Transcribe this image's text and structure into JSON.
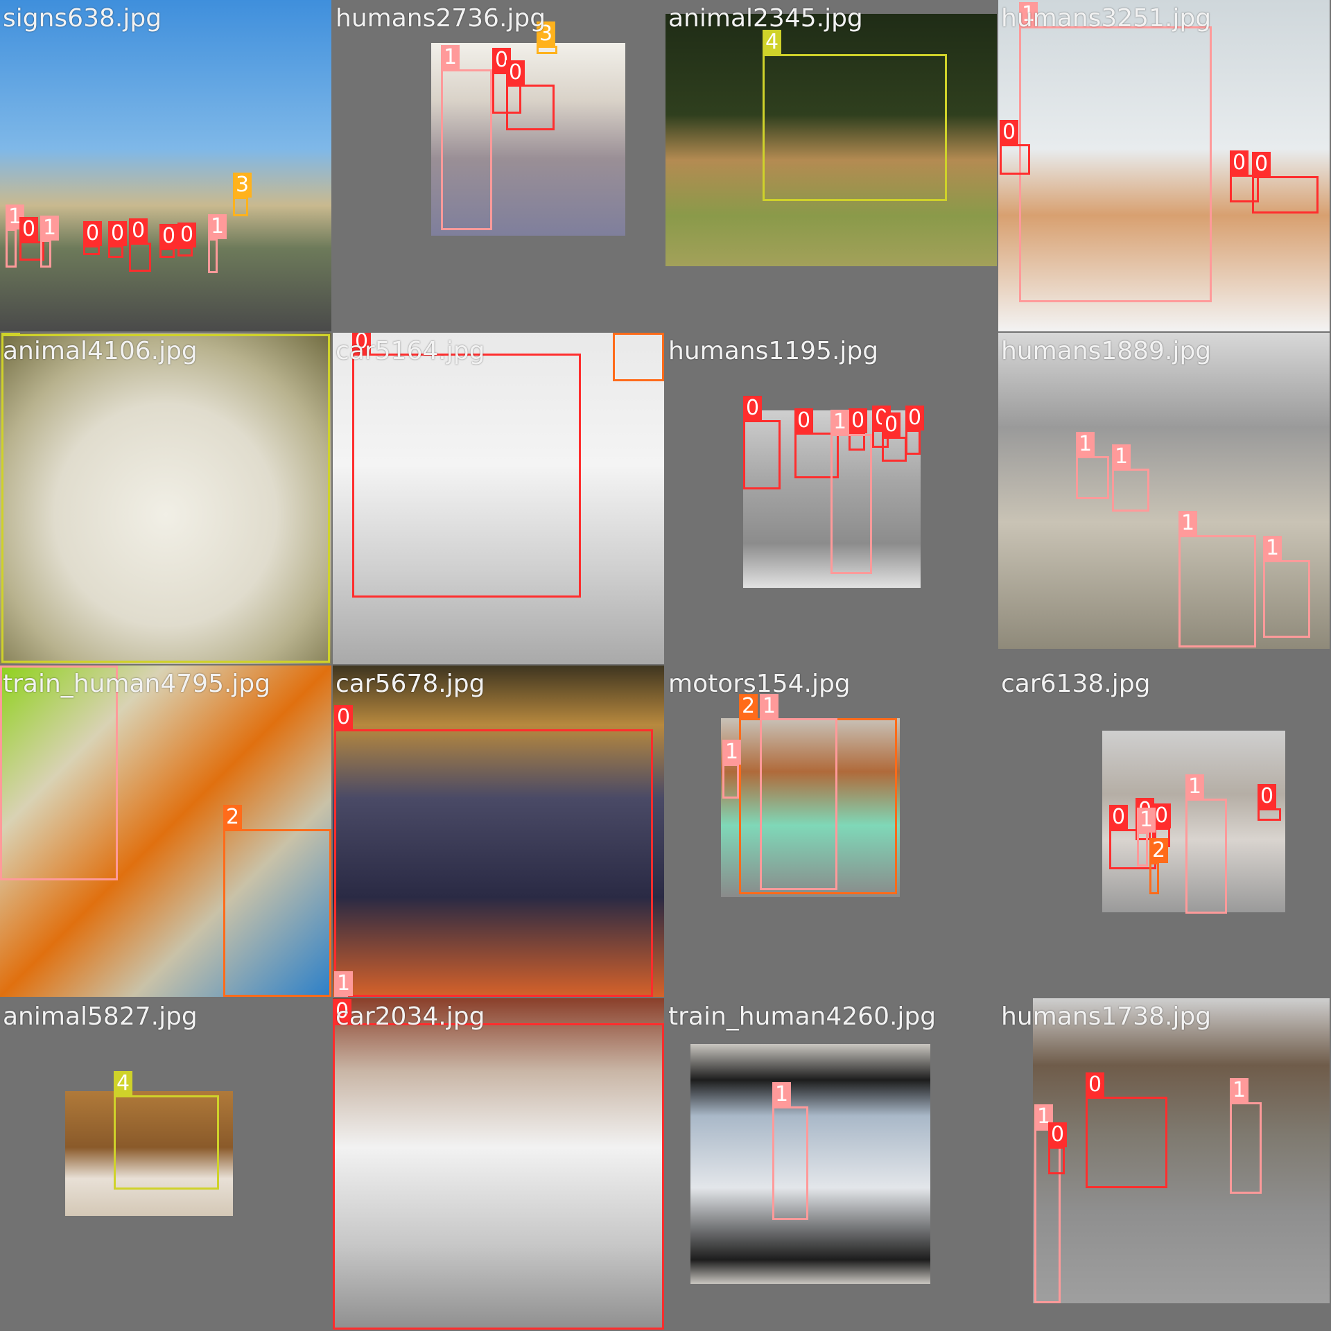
{
  "mosaic": {
    "tiles": [
      {
        "filename": "signs638.jpg",
        "labels": [
          "1",
          "0",
          "1",
          "0",
          "0",
          "0",
          "0",
          "0",
          "1",
          "3"
        ]
      },
      {
        "filename": "humans2736.jpg",
        "labels": [
          "1",
          "0",
          "0",
          "3"
        ]
      },
      {
        "filename": "animal2345.jpg",
        "labels": [
          "4"
        ]
      },
      {
        "filename": "humans3251.jpg",
        "labels": [
          "1",
          "0",
          "0",
          "0"
        ]
      },
      {
        "filename": "animal4106.jpg",
        "labels": [
          "4"
        ]
      },
      {
        "filename": "car5164.jpg",
        "labels": [
          "0",
          "2"
        ]
      },
      {
        "filename": "humans1195.jpg",
        "labels": [
          "0",
          "0",
          "0",
          "0",
          "0",
          "0",
          "1"
        ]
      },
      {
        "filename": "humans1889.jpg",
        "labels": [
          "1",
          "1",
          "1",
          "1"
        ]
      },
      {
        "filename": "train_human4795.jpg",
        "labels": [
          "1",
          "2"
        ]
      },
      {
        "filename": "car5678.jpg",
        "labels": [
          "0",
          "1"
        ]
      },
      {
        "filename": "motors154.jpg",
        "labels": [
          "2",
          "1",
          "1"
        ]
      },
      {
        "filename": "car6138.jpg",
        "labels": [
          "0",
          "0",
          "0",
          "1",
          "1",
          "2",
          "0"
        ]
      },
      {
        "filename": "animal5827.jpg",
        "labels": [
          "4"
        ]
      },
      {
        "filename": "car2034.jpg",
        "labels": [
          "0"
        ]
      },
      {
        "filename": "train_human4260.jpg",
        "labels": [
          "1"
        ]
      },
      {
        "filename": "humans1738.jpg",
        "labels": [
          "0",
          "1",
          "1",
          "0"
        ]
      }
    ]
  }
}
